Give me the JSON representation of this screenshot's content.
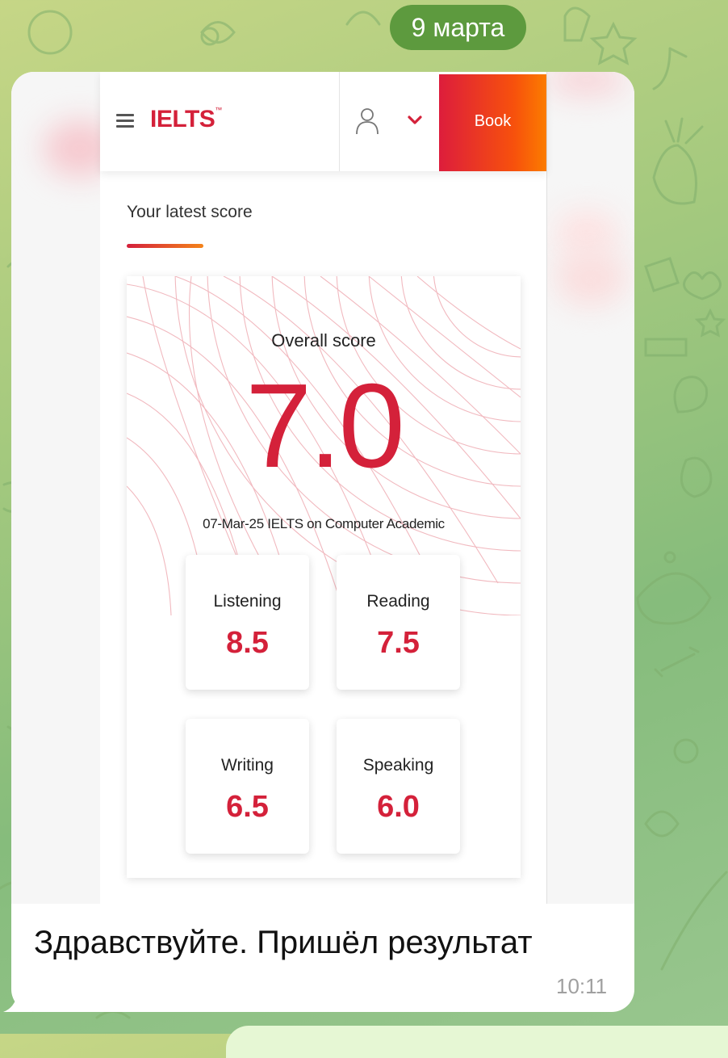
{
  "chat": {
    "date_label": "9 марта",
    "message_text": "Здравствуйте. Пришёл результат",
    "time": "10:11"
  },
  "screenshot": {
    "header": {
      "logo_text": "IELTS",
      "logo_mark": "™",
      "book_label": "Book"
    },
    "section_title": "Your latest score",
    "overall": {
      "label": "Overall score",
      "value": "7.0"
    },
    "test_info": "07-Mar-25 IELTS on Computer Academic",
    "subscores": [
      {
        "name": "Listening",
        "score": "8.5"
      },
      {
        "name": "Reading",
        "score": "7.5"
      },
      {
        "name": "Writing",
        "score": "6.5"
      },
      {
        "name": "Speaking",
        "score": "6.0"
      }
    ]
  },
  "colors": {
    "brand_red": "#d4213a",
    "book_gradient_start": "#dd1d3c",
    "book_gradient_end": "#fb7c00",
    "date_pill": "#5d9a3e",
    "chat_bg": "#a4c97e"
  },
  "icons": [
    "menu-icon",
    "user-icon",
    "chevron-down-icon"
  ]
}
